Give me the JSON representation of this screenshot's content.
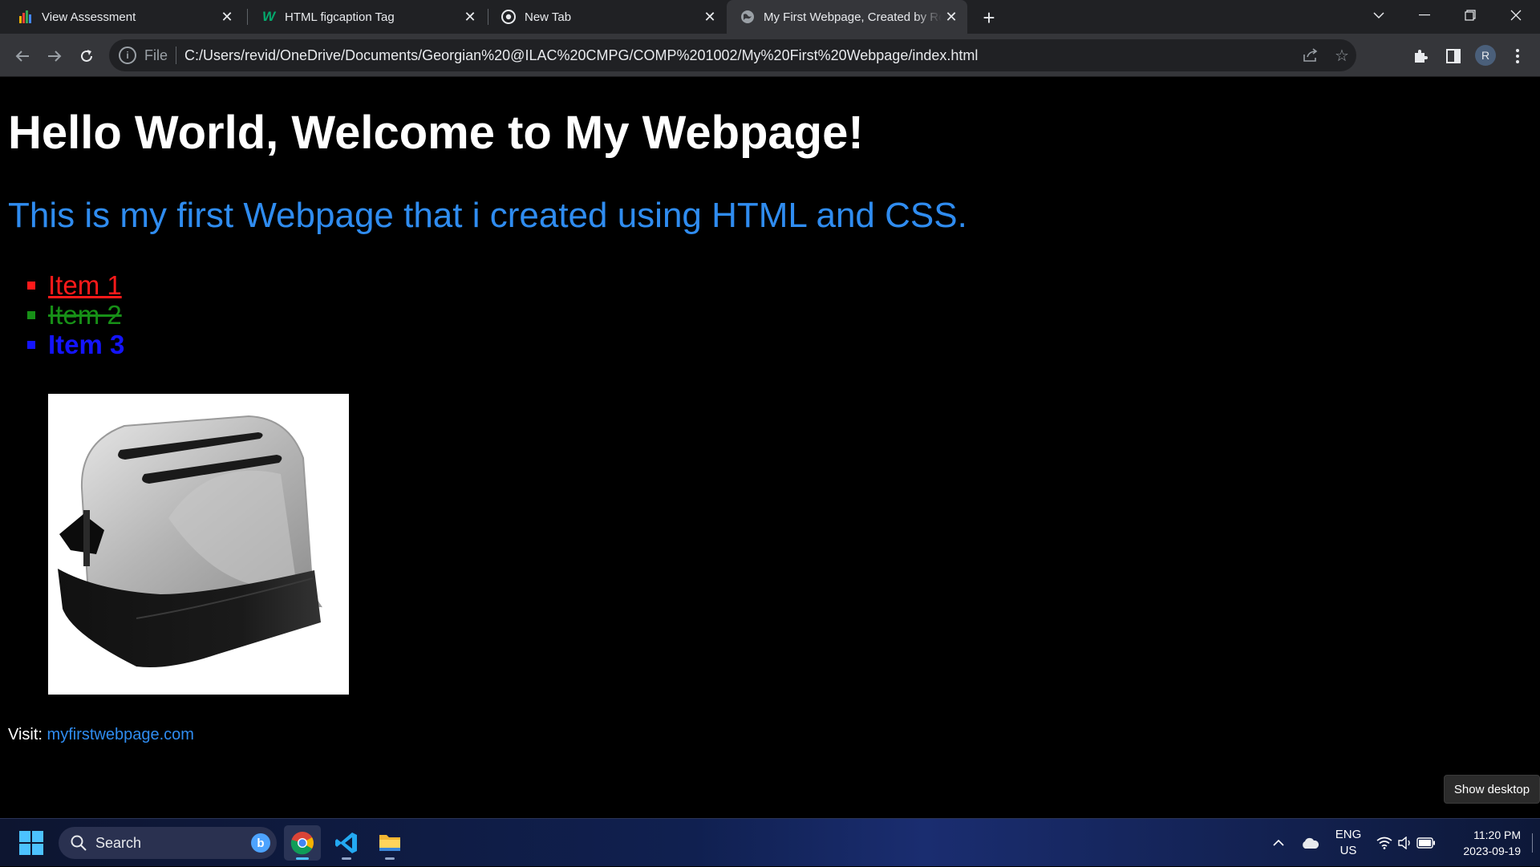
{
  "browser": {
    "tabs": [
      {
        "title": "View Assessment",
        "icon": "bar-chart-icon",
        "active": false
      },
      {
        "title": "HTML figcaption Tag",
        "icon": "w3schools-icon",
        "active": false
      },
      {
        "title": "New Tab",
        "icon": "chrome-icon",
        "active": false
      },
      {
        "title": "My First Webpage, Created by Ro",
        "icon": "globe-icon",
        "active": true
      }
    ],
    "address": {
      "scheme": "File",
      "url": "C:/Users/revid/OneDrive/Documents/Georgian%20@ILAC%20CMPG/COMP%201002/My%20First%20Webpage/index.html"
    },
    "profile_initial": "R"
  },
  "page": {
    "heading": "Hello World, Welcome to My Webpage!",
    "subheading": "This is my first Webpage that i created using HTML and CSS.",
    "list_items": [
      "Item 1",
      "Item 2",
      "Item 3"
    ],
    "image_subject": "toaster",
    "visit_label": "Visit:",
    "visit_link": "myfirstwebpage.com"
  },
  "tooltip": "Show desktop",
  "taskbar": {
    "search_label": "Search",
    "lang_primary": "ENG",
    "lang_secondary": "US",
    "time": "11:20 PM",
    "date": "2023-09-19",
    "apps": [
      "chrome-icon",
      "vscode-icon",
      "file-explorer-icon"
    ]
  },
  "colors": {
    "heading": "#ffffff",
    "subheading": "#2f8cf0",
    "item1": "#ff1a1a",
    "item2": "#179017",
    "item3": "#1414ff",
    "link": "#2f8cf0"
  }
}
